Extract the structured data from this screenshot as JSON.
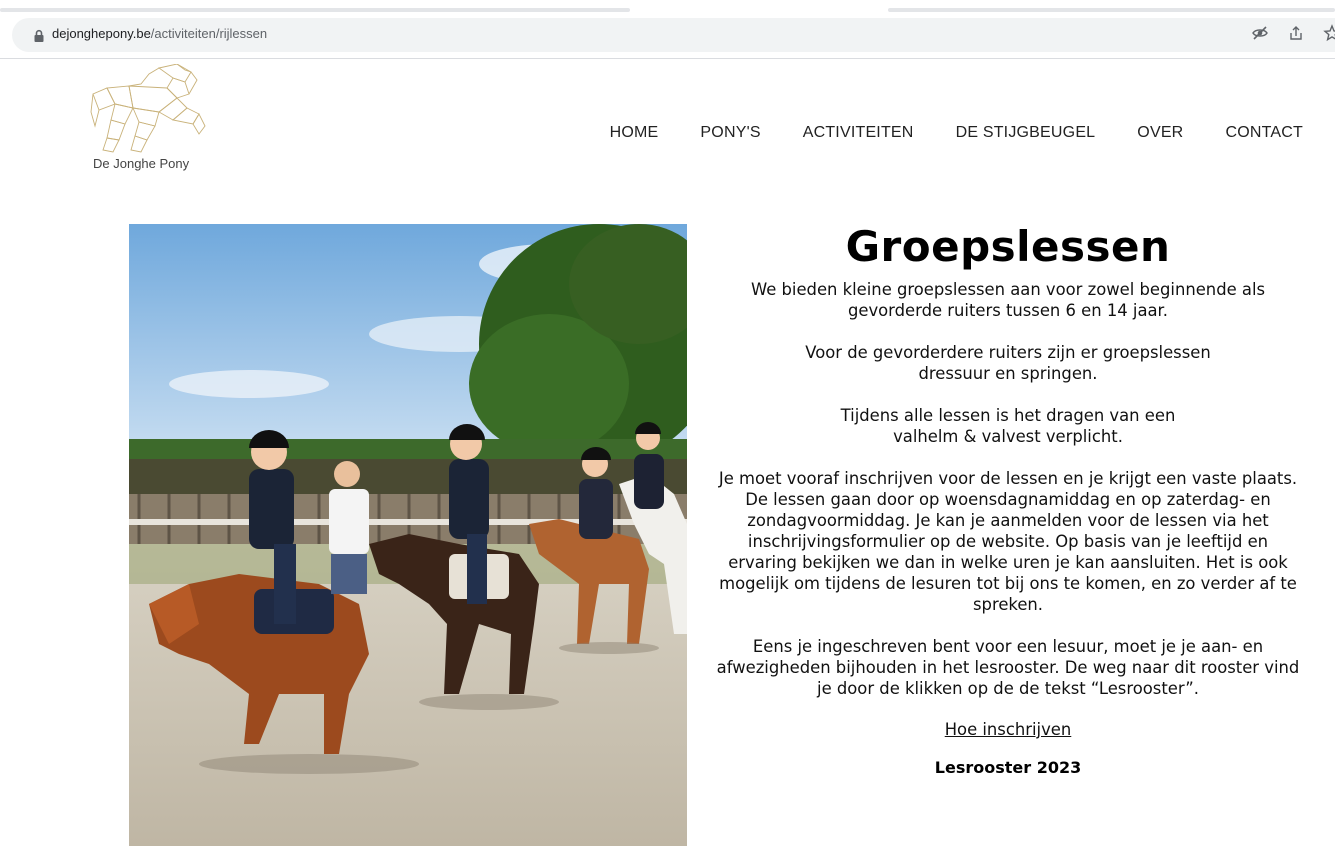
{
  "browser": {
    "url_domain": "dejonghepony.be",
    "url_path": "/activiteiten/rijlessen",
    "icons": [
      "lock-icon",
      "eye-off-icon",
      "share-icon",
      "star-icon"
    ]
  },
  "header": {
    "logo_text": "De Jonghe Pony",
    "nav": [
      "HOME",
      "PONY'S",
      "ACTIVITEITEN",
      "DE STIJGBEUGEL",
      "OVER",
      "CONTACT"
    ]
  },
  "main": {
    "title": "Groepslessen",
    "paragraphs": [
      "We bieden kleine groepslessen aan voor zowel beginnende als gevorderde ruiters tussen 6 en 14 jaar.",
      "Voor de gevorderdere ruiters zijn er groepslessen dressuur en springen.",
      "Tijdens alle lessen is het dragen van een valhelm & valvest verplicht.",
      "Je moet vooraf inschrijven voor de lessen en je krijgt een vaste plaats. De lessen gaan door op woensdagnamiddag en op zaterdag- en zondagvoormiddag. Je kan je aanmelden voor de lessen via het inschrijvingsformulier op de website. Op basis van je leeftijd en ervaring bekijken we dan in welke uren je kan aansluiten. Het is ook mogelijk om tijdens de lesuren tot bij ons te komen, en zo verder af te spreken.",
      "Eens je ingeschreven bent voor een lesuur, moet je je aan- en afwezigheden bijhouden in het lesrooster. De weg naar dit rooster vind je door de klikken op de de tekst “Lesrooster”."
    ],
    "link_label": "Hoe inschrijven",
    "schedule_label": "Lesrooster 2023"
  },
  "colors": {
    "chrome_bg": "#f1f3f4",
    "logo_gold": "#c9b27a",
    "text": "#111111"
  }
}
